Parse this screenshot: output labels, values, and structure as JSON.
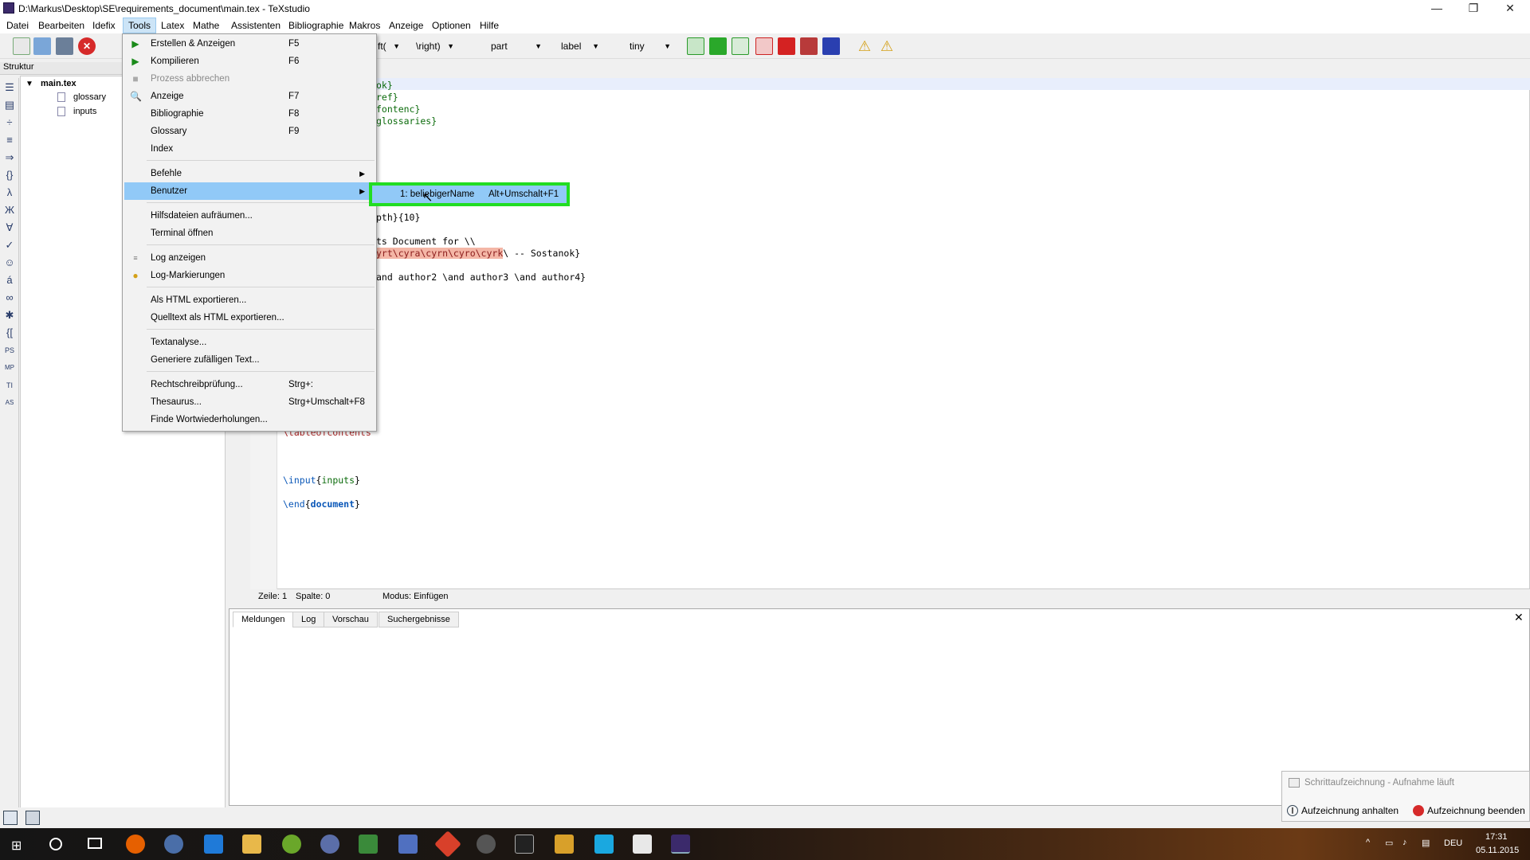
{
  "window": {
    "title": "D:\\Markus\\Desktop\\SE\\requirements_document\\main.tex - TeXstudio",
    "minimize": "—",
    "maximize": "❐",
    "close": "✕"
  },
  "menubar": [
    "Datei",
    "Bearbeiten",
    "Idefix",
    "Tools",
    "Latex",
    "Mathe",
    "Assistenten",
    "Bibliographie",
    "Makros",
    "Anzeige",
    "Optionen",
    "Hilfe"
  ],
  "toolbar": {
    "combo_left": "ft(",
    "combo_right": "\\right)",
    "combo_part": "part",
    "combo_label": "label",
    "combo_size": "tiny"
  },
  "structure": {
    "header": "Struktur",
    "root": "main.tex",
    "children": [
      "glossary",
      "inputs"
    ]
  },
  "editor": {
    "lines": {
      "l1a": "ok}",
      "l2a": "ref}",
      "l3a": "fontenc}",
      "l4a": "glossaries}",
      "l10": "pth}{10}",
      "l12": "ts Document for \\\\",
      "l13_err": "yrt\\cyra\\cyrn\\cyro\\cyrk",
      "l13_rest": "\\ -- Sostanok}",
      "l15": "and author2 \\and author3 \\and author4}",
      "toc_cmd": "\\tableofcontents",
      "input_cmd": "\\input",
      "input_arg": "inputs",
      "end_cmd": "\\end",
      "end_arg": "document"
    },
    "status": {
      "line": "Zeile: 1",
      "col": "Spalte: 0",
      "mode": "Modus: Einfügen"
    }
  },
  "bottom_panel": {
    "tabs": [
      "Meldungen",
      "Log",
      "Vorschau",
      "Suchergebnisse"
    ],
    "close": "✕"
  },
  "tools_menu": {
    "items": [
      {
        "label": "Erstellen & Anzeigen",
        "shortcut": "F5"
      },
      {
        "label": "Kompilieren",
        "shortcut": "F6"
      },
      {
        "label": "Prozess abbrechen",
        "shortcut": ""
      },
      {
        "label": "Anzeige",
        "shortcut": "F7"
      },
      {
        "label": "Bibliographie",
        "shortcut": "F8"
      },
      {
        "label": "Glossary",
        "shortcut": "F9"
      },
      {
        "label": "Index",
        "shortcut": ""
      },
      {
        "label": "Befehle",
        "shortcut": ""
      },
      {
        "label": "Benutzer",
        "shortcut": ""
      },
      {
        "label": "Hilfsdateien aufräumen...",
        "shortcut": ""
      },
      {
        "label": "Terminal öffnen",
        "shortcut": ""
      },
      {
        "label": "Log anzeigen",
        "shortcut": ""
      },
      {
        "label": "Log-Markierungen",
        "shortcut": ""
      },
      {
        "label": "Als HTML exportieren...",
        "shortcut": ""
      },
      {
        "label": "Quelltext als HTML exportieren...",
        "shortcut": ""
      },
      {
        "label": "Textanalyse...",
        "shortcut": ""
      },
      {
        "label": "Generiere zufälligen Text...",
        "shortcut": ""
      },
      {
        "label": "Rechtschreibprüfung...",
        "shortcut": "Strg+:"
      },
      {
        "label": "Thesaurus...",
        "shortcut": "Strg+Umschalt+F8"
      },
      {
        "label": "Finde Wortwiederholungen...",
        "shortcut": ""
      }
    ],
    "submenu": {
      "label": "1: beliebigerName",
      "shortcut": "Alt+Umschalt+F1"
    }
  },
  "notification": {
    "title": "Schrittaufzeichnung - Aufnahme läuft",
    "pause": "Aufzeichnung anhalten",
    "stop": "Aufzeichnung beenden"
  },
  "tray": {
    "lang": "DEU",
    "time": "17:31",
    "date": "05.11.2015"
  }
}
